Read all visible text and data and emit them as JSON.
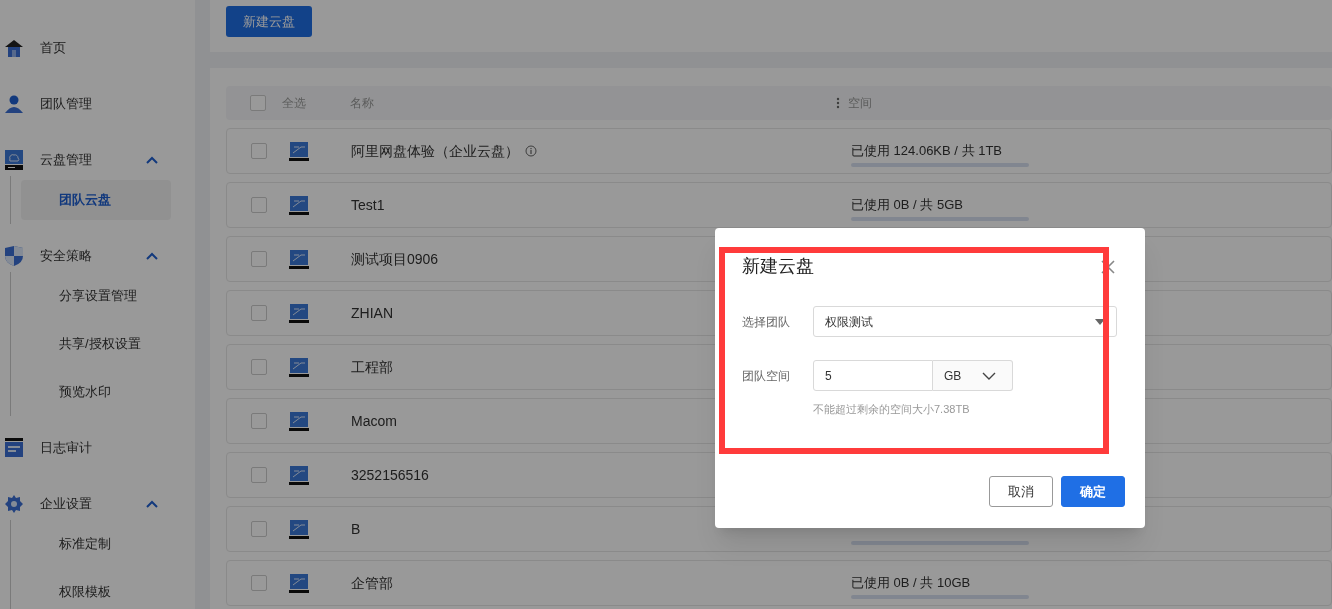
{
  "sidebar": {
    "items": [
      {
        "label": "首页",
        "selected": false
      },
      {
        "label": "团队管理",
        "selected": false
      },
      {
        "label": "云盘管理",
        "selected": false,
        "expanded": true,
        "children": [
          {
            "label": "团队云盘",
            "selected": true
          }
        ]
      },
      {
        "label": "安全策略",
        "selected": false,
        "expanded": true,
        "children": [
          {
            "label": "分享设置管理",
            "selected": false
          },
          {
            "label": "共享/授权设置",
            "selected": false
          },
          {
            "label": "预览水印",
            "selected": false
          }
        ]
      },
      {
        "label": "日志审计",
        "selected": false
      },
      {
        "label": "企业设置",
        "selected": false,
        "expanded": true,
        "children": [
          {
            "label": "标准定制",
            "selected": false
          },
          {
            "label": "权限模板",
            "selected": false
          }
        ]
      }
    ]
  },
  "toolbar": {
    "button": "新建云盘"
  },
  "table": {
    "select_all": "全选",
    "select_all_checked": false,
    "columns": [
      "名称",
      "空间"
    ],
    "rows": [
      {
        "name": "阿里网盘体验（企业云盘）",
        "info": true,
        "checked": false,
        "space": "已使用 124.06KB / 共 1TB",
        "level": 0
      },
      {
        "name": "Test1",
        "info": false,
        "checked": false,
        "space": "已使用 0B / 共 5GB",
        "level": 0
      },
      {
        "name": "测试项目0906",
        "info": false,
        "checked": false
      },
      {
        "name": "ZHIAN",
        "info": false,
        "checked": false
      },
      {
        "name": "工程部",
        "info": false,
        "checked": false
      },
      {
        "name": "Macom",
        "info": false,
        "checked": false
      },
      {
        "name": "3252156516",
        "info": false,
        "checked": false
      },
      {
        "name": "B",
        "info": false,
        "checked": false,
        "level": 0
      },
      {
        "name": "企管部",
        "info": false,
        "checked": false,
        "space": "已使用 0B / 共 10GB",
        "level": 0
      }
    ]
  },
  "dialog": {
    "title": "新建云盘",
    "team": {
      "label": "选择团队",
      "value": "权限测试"
    },
    "space": {
      "label": "团队空间",
      "value": "5",
      "unit": "GB",
      "hint": "不能超过剩余的空间大小7.38TB"
    },
    "buttons": [
      {
        "label": "取消",
        "kind": "secondary"
      },
      {
        "label": "确定",
        "kind": "primary"
      }
    ]
  }
}
